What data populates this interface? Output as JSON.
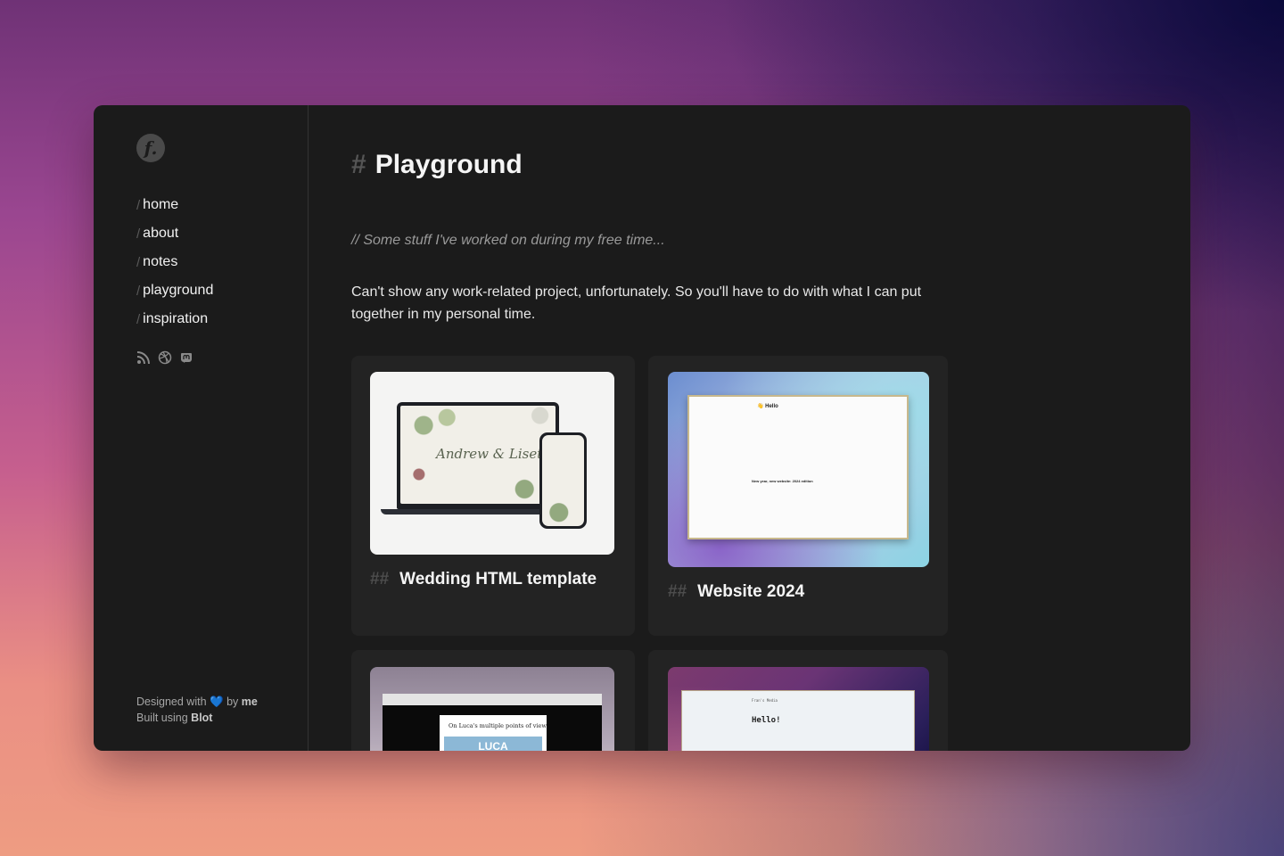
{
  "sidebar": {
    "logo_letter": "f.",
    "nav_separator": "/",
    "nav": [
      {
        "label": "home"
      },
      {
        "label": "about"
      },
      {
        "label": "notes"
      },
      {
        "label": "playground"
      },
      {
        "label": "inspiration"
      }
    ],
    "social": [
      {
        "icon": "rss-icon"
      },
      {
        "icon": "dribbble-icon"
      },
      {
        "icon": "mastodon-icon"
      }
    ],
    "footer": {
      "designed_prefix": "Designed with",
      "heart": "💙",
      "by_text": "by",
      "author": "me",
      "built_prefix": "Built using",
      "platform": "Blot"
    }
  },
  "main": {
    "title_hash": "#",
    "title": "Playground",
    "subtitle": "// Some stuff I've worked on during my free time...",
    "intro": "Can't show any work-related project, unfortunately. So you'll have to do with what I can put together in my personal time.",
    "projects": [
      {
        "hash": "##",
        "title": "Wedding HTML template",
        "thumb_text": "Andrew & Liset"
      },
      {
        "hash": "##",
        "title": "Website 2024",
        "thumb_text": "👋 Hello",
        "thumb_post": "New year, new website: 2024 edition"
      },
      {
        "hash": "##",
        "title": "",
        "thumb_text": "On Luca's multiple points of view",
        "thumb_sub": "LUCA"
      },
      {
        "hash": "##",
        "title": "",
        "thumb_text": "Hello!",
        "thumb_brand": "Fran's Media"
      }
    ]
  }
}
